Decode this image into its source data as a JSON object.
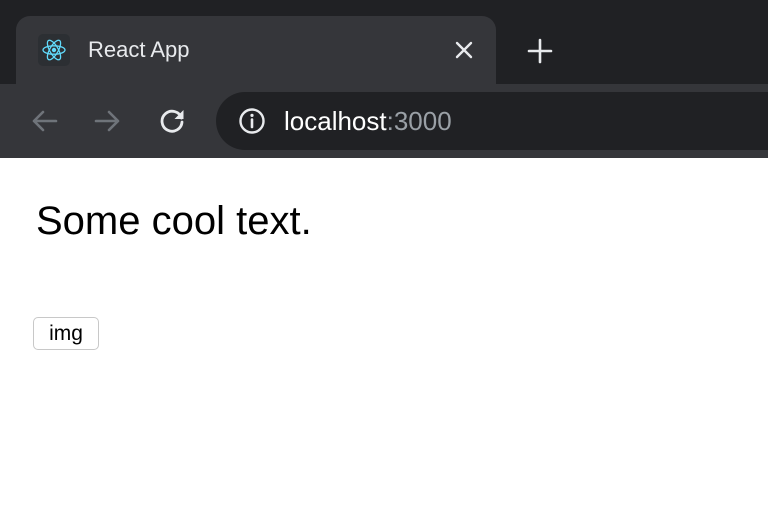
{
  "browser": {
    "tab": {
      "title": "React App",
      "favicon_icon": "react-atom-icon",
      "close_icon": "close-icon"
    },
    "new_tab_icon": "plus-icon",
    "toolbar": {
      "back_icon": "arrow-left-icon",
      "forward_icon": "arrow-right-icon",
      "reload_icon": "reload-icon",
      "info_icon": "info-icon"
    },
    "address": {
      "host": "localhost",
      "port": ":3000"
    },
    "colors": {
      "tabstrip": "#202124",
      "active_tab": "#35363a",
      "react": "#61dafb"
    }
  },
  "page": {
    "heading": "Some cool text.",
    "image_button_label": "img"
  }
}
